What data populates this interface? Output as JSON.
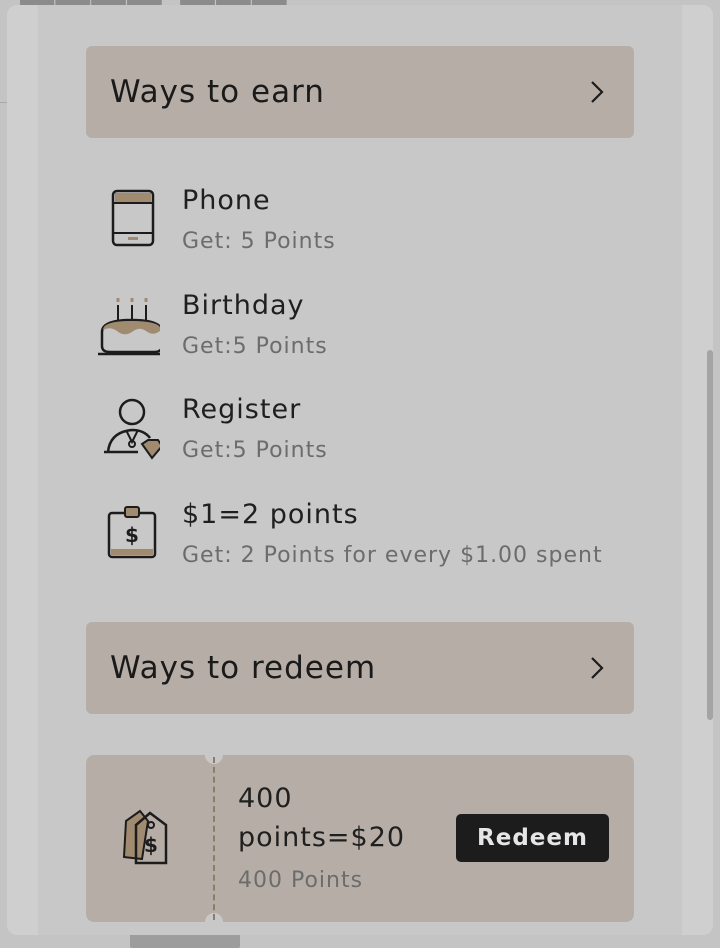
{
  "colors": {
    "accent": "#a08b70",
    "panel": "#b6aea6",
    "button": "#1c1c1c"
  },
  "earn_section": {
    "title": "Ways to earn",
    "items": [
      {
        "icon": "phone-icon",
        "title": "Phone",
        "subtitle": "Get: 5 Points"
      },
      {
        "icon": "birthday-cake-icon",
        "title": "Birthday",
        "subtitle": "Get:5 Points"
      },
      {
        "icon": "register-user-icon",
        "title": "Register",
        "subtitle": "Get:5 Points"
      },
      {
        "icon": "spend-clipboard-icon",
        "title": "$1=2 points",
        "subtitle": "Get: 2 Points for every $1.00 spent"
      }
    ]
  },
  "redeem_section": {
    "title": "Ways to redeem",
    "coupon": {
      "icon": "price-tag-icon",
      "title": "400 points=$20",
      "subtitle": "400 Points",
      "button_label": "Redeem"
    }
  }
}
